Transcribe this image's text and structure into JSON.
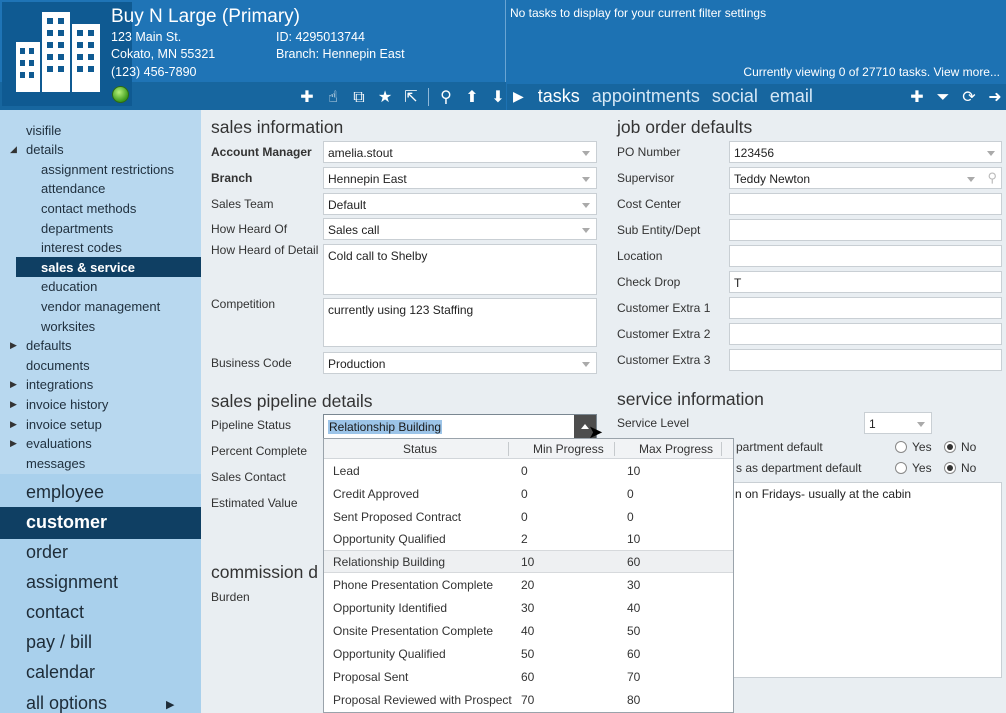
{
  "header": {
    "company_name": "Buy N Large (Primary)",
    "address_line1": "123 Main St.",
    "address_line2": "Cokato, MN    55321",
    "phone": "(123) 456-7890",
    "id_line": "ID:  4295013744",
    "branch_line": "Branch:  Hennepin East",
    "icons": [
      "plus-icon",
      "hand-pointer-icon",
      "puzzle-icon",
      "star-icon",
      "external-link-icon",
      "search-icon",
      "arrow-up-icon",
      "arrow-down-icon"
    ]
  },
  "tasks_panel": {
    "no_tasks": "No tasks to display for your current filter settings",
    "viewing": "Currently viewing 0 of 27710 tasks. View more...",
    "tabs": [
      "tasks",
      "appointments",
      "social",
      "email"
    ],
    "icons": [
      "plus-icon",
      "filter-icon",
      "refresh-icon",
      "arrow-right-icon"
    ]
  },
  "sidebar": {
    "items": [
      {
        "label": "visifile"
      },
      {
        "label": "details"
      },
      {
        "label": "assignment restrictions"
      },
      {
        "label": "attendance"
      },
      {
        "label": "contact methods"
      },
      {
        "label": "departments"
      },
      {
        "label": "interest codes"
      },
      {
        "label": "sales & service"
      },
      {
        "label": "education"
      },
      {
        "label": "vendor management"
      },
      {
        "label": "worksites"
      },
      {
        "label": "defaults"
      },
      {
        "label": "documents"
      },
      {
        "label": "integrations"
      },
      {
        "label": "invoice history"
      },
      {
        "label": "invoice setup"
      },
      {
        "label": "evaluations"
      },
      {
        "label": "messages"
      }
    ],
    "big_items": [
      "employee",
      "customer",
      "order",
      "assignment",
      "contact",
      "pay / bill",
      "calendar",
      "all options"
    ]
  },
  "sales_information": {
    "title": "sales information",
    "account_manager_label": "Account Manager",
    "account_manager": "amelia.stout",
    "branch_label": "Branch",
    "branch": "Hennepin East",
    "sales_team_label": "Sales Team",
    "sales_team": "Default",
    "how_heard_label": "How Heard Of",
    "how_heard": "Sales call",
    "how_heard_detail_label": "How Heard of Detail",
    "how_heard_detail": "Cold call to Shelby",
    "competition_label": "Competition",
    "competition": "currently using 123 Staffing",
    "business_code_label": "Business Code",
    "business_code": "Production"
  },
  "job_order_defaults": {
    "title": "job order defaults",
    "po_label": "PO Number",
    "po": "123456",
    "supervisor_label": "Supervisor",
    "supervisor": "Teddy Newton",
    "cost_center_label": "Cost Center",
    "sub_entity_label": "Sub Entity/Dept",
    "location_label": "Location",
    "check_drop_label": "Check Drop",
    "check_drop": "T",
    "extra1_label": "Customer Extra 1",
    "extra2_label": "Customer Extra 2",
    "extra3_label": "Customer Extra 3"
  },
  "pipeline": {
    "title": "sales pipeline details",
    "status_label": "Pipeline Status",
    "status_value": "Relationship Building",
    "percent_label": "Percent Complete",
    "contact_label": "Sales Contact",
    "estimated_label": "Estimated Value"
  },
  "commission": {
    "title": "commission d",
    "burden_label": "Burden"
  },
  "service_information": {
    "title": "service information",
    "level_label": "Service Level",
    "level": "1",
    "row1_label": "partment default",
    "row2_label": "s as department default",
    "yes": "Yes",
    "no": "No",
    "note": "n on Fridays- usually at the cabin"
  },
  "popup": {
    "headers": [
      "Status",
      "Min Progress",
      "Max Progress"
    ],
    "rows": [
      {
        "status": "Lead",
        "min": "0",
        "max": "10"
      },
      {
        "status": "Credit Approved",
        "min": "0",
        "max": "0"
      },
      {
        "status": "Sent Proposed Contract",
        "min": "0",
        "max": "0"
      },
      {
        "status": "Opportunity Qualified",
        "min": "2",
        "max": "10"
      },
      {
        "status": "Relationship Building",
        "min": "10",
        "max": "60"
      },
      {
        "status": "Phone Presentation Complete",
        "min": "20",
        "max": "30"
      },
      {
        "status": "Opportunity Identified",
        "min": "30",
        "max": "40"
      },
      {
        "status": "Onsite Presentation Complete",
        "min": "40",
        "max": "50"
      },
      {
        "status": "Opportunity Qualified",
        "min": "50",
        "max": "60"
      },
      {
        "status": "Proposal Sent",
        "min": "60",
        "max": "70"
      },
      {
        "status": "Proposal Reviewed with Prospect",
        "min": "70",
        "max": "80"
      }
    ]
  }
}
